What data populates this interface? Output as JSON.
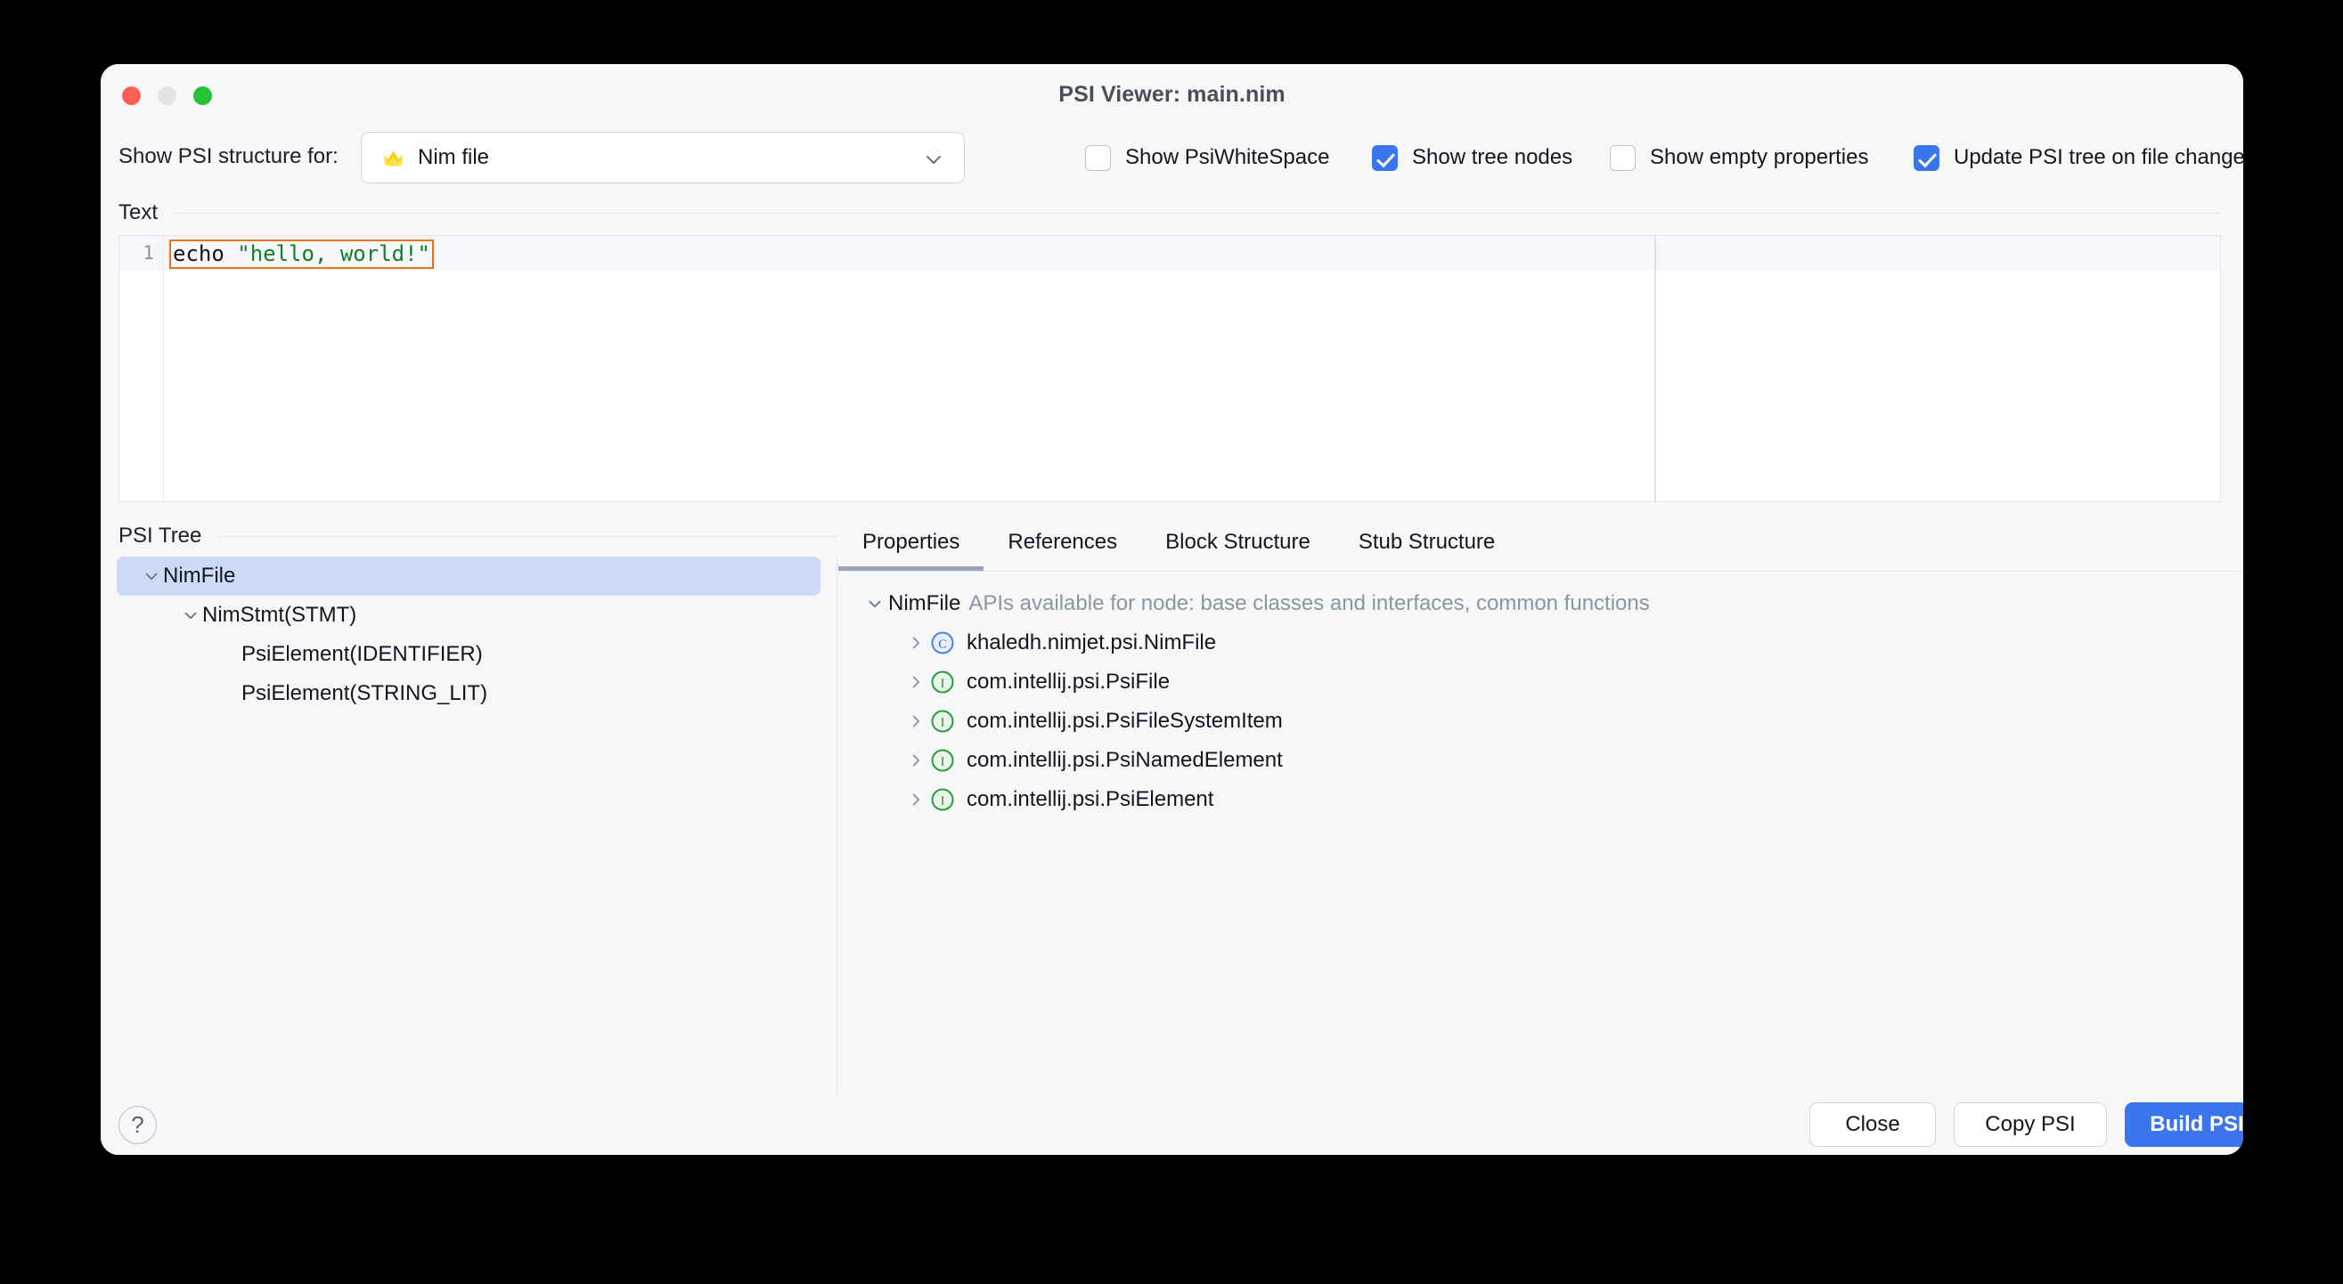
{
  "window": {
    "title": "PSI Viewer: main.nim",
    "traffic_lights": [
      "close",
      "minimize",
      "maximize"
    ]
  },
  "toolbar": {
    "structure_label": "Show PSI structure for:",
    "file_type_select": {
      "value": "Nim file",
      "icon": "nim-file-icon",
      "chevron": "chevron-down-icon"
    },
    "checkboxes": [
      {
        "label": "Show PsiWhiteSpace",
        "checked": false
      },
      {
        "label": "Show tree nodes",
        "checked": true
      },
      {
        "label": "Show empty properties",
        "checked": false
      },
      {
        "label": "Update PSI tree on file changes",
        "checked": true
      }
    ]
  },
  "text_section": {
    "label": "Text",
    "line_number": "1",
    "code": {
      "keyword": "echo ",
      "string": "\"hello, world!\""
    }
  },
  "psi_tree": {
    "label": "PSI Tree",
    "nodes": [
      {
        "label": "NimFile",
        "indent": 0,
        "expanded": true,
        "selected": true
      },
      {
        "label": "NimStmt(STMT)",
        "indent": 1,
        "expanded": true,
        "selected": false
      },
      {
        "label": "PsiElement(IDENTIFIER)",
        "indent": 2,
        "expanded": false,
        "selected": false
      },
      {
        "label": "PsiElement(STRING_LIT)",
        "indent": 2,
        "expanded": false,
        "selected": false
      }
    ]
  },
  "detail_panel": {
    "tabs": [
      {
        "label": "Properties",
        "active": true
      },
      {
        "label": "References",
        "active": false
      },
      {
        "label": "Block Structure",
        "active": false
      },
      {
        "label": "Stub Structure",
        "active": false
      }
    ],
    "root": {
      "name": "NimFile",
      "hint": "APIs available for node: base classes and interfaces, common functions"
    },
    "items": [
      {
        "label": "khaledh.nimjet.psi.NimFile",
        "kind": "class"
      },
      {
        "label": "com.intellij.psi.PsiFile",
        "kind": "interface"
      },
      {
        "label": "com.intellij.psi.PsiFileSystemItem",
        "kind": "interface"
      },
      {
        "label": "com.intellij.psi.PsiNamedElement",
        "kind": "interface"
      },
      {
        "label": "com.intellij.psi.PsiElement",
        "kind": "interface"
      }
    ]
  },
  "footer": {
    "help_label": "?",
    "close_label": "Close",
    "copy_label": "Copy PSI",
    "build_label": "Build PSI Tree"
  },
  "colors": {
    "accent": "#3b75ed",
    "selection": "#ccd9f7",
    "highlight_border": "#ec7211",
    "string_literal": "#118021",
    "class_icon": "#4f7fe0",
    "interface_icon": "#2a9b3f",
    "tab_underline": "#9aa3b8"
  }
}
